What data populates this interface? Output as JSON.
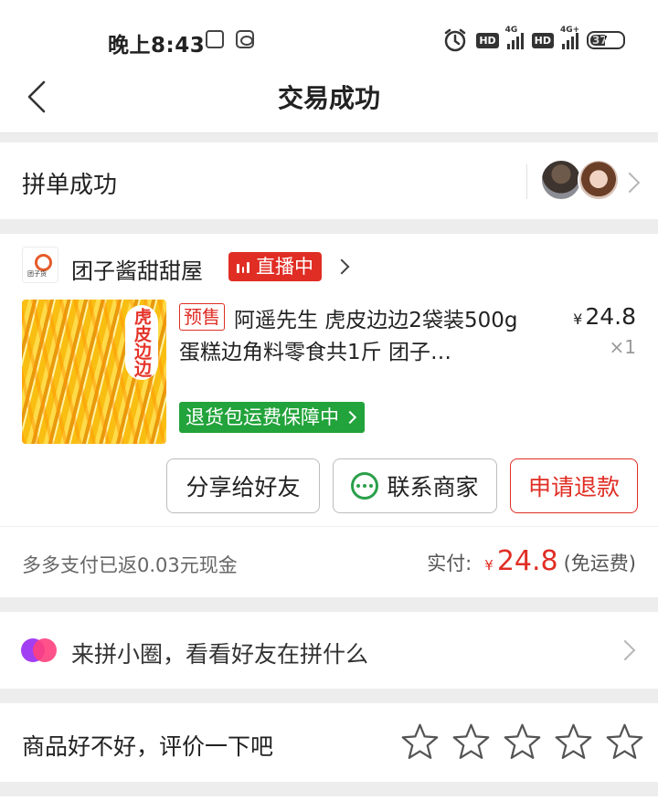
{
  "status_bar": {
    "time": "晚上8:43",
    "network_badges": [
      "HD",
      "HD"
    ],
    "signal_labels": [
      "4G",
      "4G+"
    ],
    "battery": "37"
  },
  "nav": {
    "title": "交易成功",
    "back_icon": "chevron-left-icon"
  },
  "group": {
    "label": "拼单成功",
    "members": [
      "member-avatar-1",
      "member-avatar-2"
    ],
    "chevron_icon": "chevron-right-icon"
  },
  "shop": {
    "name": "团子酱甜甜屋",
    "logo_text": "团子货",
    "live_label": "直播中"
  },
  "product": {
    "image_label": "虎皮边边",
    "presale_label": "预售",
    "title": "阿遥先生 虎皮边边2袋装500g 蛋糕边角料零食共1斤 团子…",
    "currency": "¥",
    "price": "24.8",
    "quantity": "×1",
    "guarantee": "退货包运费保障中"
  },
  "actions": {
    "share": "分享给好友",
    "contact": "联系商家",
    "refund": "申请退款",
    "contact_icon": "chat-icon"
  },
  "payment": {
    "cashback": "多多支付已返0.03元现金",
    "paid_label": "实付:",
    "currency": "¥",
    "amount": "24.8",
    "shipping": "(免运费)"
  },
  "circle": {
    "label": "来拼小圈，看看好友在拼什么",
    "icon": "friends-circle-icon"
  },
  "review": {
    "label": "商品好不好，评价一下吧",
    "stars": 5
  },
  "colors": {
    "brand_red": "#e02e24",
    "green": "#22a33b",
    "background": "#ededed",
    "chat_green": "#2aa04a",
    "circle_purple": "#a33ff2",
    "circle_pink": "#ff3f7d"
  }
}
